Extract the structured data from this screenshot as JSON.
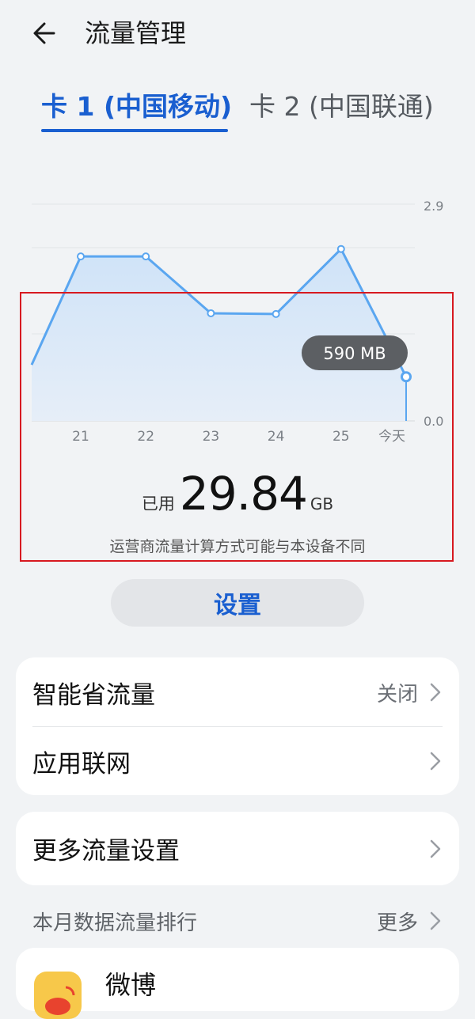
{
  "header": {
    "title": "流量管理",
    "back_icon": "arrow-left-icon"
  },
  "tabs": [
    {
      "label": "卡 1 (中国移动)",
      "active": true
    },
    {
      "label": "卡 2 (中国联通)",
      "active": false
    }
  ],
  "chart_data": {
    "type": "area",
    "categories": [
      "21",
      "22",
      "23",
      "24",
      "25",
      "今天"
    ],
    "x_partial_left": true,
    "values": [
      2.2,
      2.2,
      1.44,
      1.43,
      2.3,
      0.59
    ],
    "left_partial_value": 0.75,
    "y_ticks": [
      "2.9",
      "0.0"
    ],
    "tooltip": "590 MB",
    "grid": true,
    "colors": {
      "line": "#5aa6f0",
      "fill_top": "#cfe3f8",
      "fill_bottom": "#e6eef8"
    }
  },
  "usage": {
    "label": "已用",
    "value": "29.84",
    "unit": "GB"
  },
  "notice": "运营商流量计算方式可能与本设备不同",
  "settings_button": "设置",
  "cards": {
    "smart_saver": {
      "label": "智能省流量",
      "value": "关闭"
    },
    "app_network": {
      "label": "应用联网"
    },
    "more_settings": {
      "label": "更多流量设置"
    }
  },
  "ranking": {
    "title": "本月数据流量排行",
    "more": "更多",
    "items": [
      {
        "name": "微博",
        "icon": "weibo-icon"
      }
    ]
  },
  "colors": {
    "accent": "#1a5fd0",
    "background": "#f1f3f5",
    "highlight": "#d71920"
  }
}
